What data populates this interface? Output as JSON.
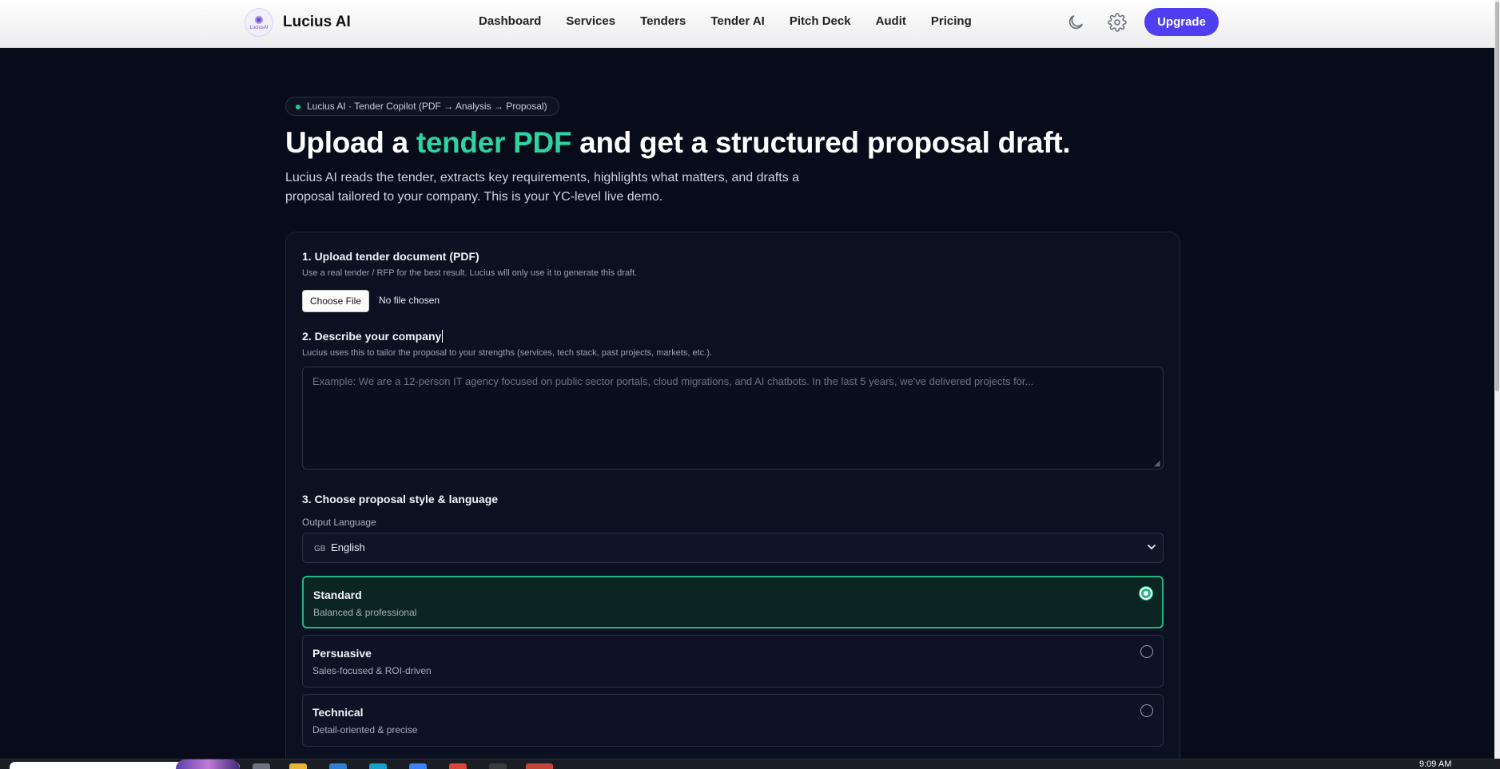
{
  "app": {
    "brand_name": "Lucius AI",
    "logo_text": "LuciusAI"
  },
  "nav": {
    "links": [
      "Dashboard",
      "Services",
      "Tenders",
      "Tender AI",
      "Pitch Deck",
      "Audit",
      "Pricing"
    ],
    "icons": [
      "moon-icon",
      "gear-icon"
    ],
    "upgrade_label": "Upgrade"
  },
  "hero": {
    "pill_text": "Lucius AI · Tender Copilot (PDF → Analysis → Proposal)",
    "title_before": "Upload a ",
    "title_accent": "tender PDF",
    "title_after": " and get a structured proposal draft.",
    "subtitle": "Lucius AI reads the tender, extracts key requirements, highlights what matters, and drafts a proposal tailored to your company. This is your YC-level live demo."
  },
  "form": {
    "step1": {
      "title": "1. Upload tender document (PDF)",
      "hint": "Use a real tender / RFP for the best result. Lucius will only use it to generate this draft.",
      "button_label": "Choose File",
      "file_status": "No file chosen"
    },
    "step2": {
      "title": "2. Describe your company",
      "hint": "Lucius uses this to tailor the proposal to your strengths (services, tech stack, past projects, markets, etc.).",
      "placeholder": "Example: We are a 12-person IT agency focused on public sector portals, cloud migrations, and AI chatbots. In the last 5 years, we've delivered projects for...",
      "value": ""
    },
    "step3": {
      "title": "3. Choose proposal style & language",
      "language_label": "Output Language",
      "language_flag": "GB",
      "language_value": "English",
      "styles": [
        {
          "name": "Standard",
          "desc": "Balanced & professional",
          "selected": true
        },
        {
          "name": "Persuasive",
          "desc": "Sales-focused & ROI-driven",
          "selected": false
        },
        {
          "name": "Technical",
          "desc": "Detail-oriented & precise",
          "selected": false
        }
      ]
    }
  },
  "taskbar": {
    "clock": "9:09 AM"
  },
  "colors": {
    "background": "#070b1a",
    "accent_green": "#2ed3a0",
    "upgrade_purple": "#4f3ff0",
    "selected_border": "#1fb784"
  }
}
